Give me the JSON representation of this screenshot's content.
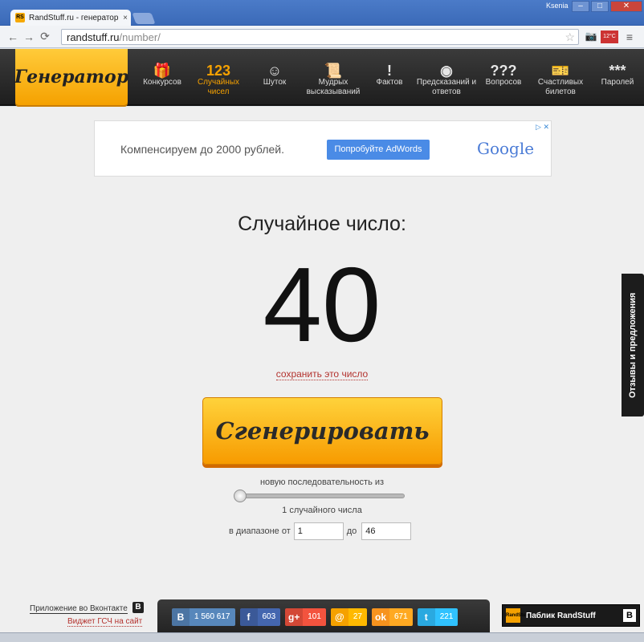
{
  "browser": {
    "tab_title": "RandStuff.ru - генератор сл",
    "tab_close": "×",
    "favicon_text": "RS",
    "user": "Ksenia",
    "window_buttons": {
      "minimize": "–",
      "maximize": "□",
      "close": "✕"
    },
    "nav": {
      "back": "←",
      "forward": "→",
      "reload": "⟳"
    },
    "url_host": "randstuff.ru",
    "url_path": "/number/",
    "star": "☆",
    "toolbar_icons": {
      "camera": "📷",
      "weather": "12°C",
      "menu": "≡"
    }
  },
  "site": {
    "logo": "Генератор",
    "menu": [
      {
        "icon": "🎁",
        "label": "Конкурсов"
      },
      {
        "icon": "123",
        "label": "Случайных чисел",
        "active": true
      },
      {
        "icon": "☺",
        "label": "Шуток"
      },
      {
        "icon": "📜",
        "label": "Мудрых высказываний"
      },
      {
        "icon": "!",
        "label": "Фактов"
      },
      {
        "icon": "◉",
        "label": "Предсказаний и ответов"
      },
      {
        "icon": "???",
        "label": "Вопросов"
      },
      {
        "icon": "🎫",
        "label": "Счастливых билетов"
      },
      {
        "icon": "***",
        "label": "Паролей"
      }
    ]
  },
  "ad": {
    "text": "Компенсируем до 2000 рублей.",
    "button": "Попробуйте AdWords",
    "brand": "Google",
    "close": "▷ ✕"
  },
  "result": {
    "title": "Случайное число:",
    "number": "40",
    "save_link": "сохранить это число"
  },
  "generator": {
    "button": "Сгенерировать",
    "sequence_label": "новую последовательность из",
    "count_label": "1 случайного числа",
    "range_from_label": "в диапазоне от",
    "range_from": "1",
    "range_to_label": "до",
    "range_to": "46",
    "slider_value": 1
  },
  "feedback": "Отзывы и предложения",
  "footer": {
    "vk_app": "Приложение во Вконтакте",
    "vk_badge": "B",
    "widget": "Виджет ГСЧ на сайт",
    "social": [
      {
        "icon": "B",
        "count": "1 560 617",
        "color": "#4c75a3"
      },
      {
        "icon": "f",
        "count": "603",
        "color": "#3b5998"
      },
      {
        "icon": "g+",
        "count": "101",
        "color": "#d34836"
      },
      {
        "icon": "@",
        "count": "27",
        "color": "#f5a100"
      },
      {
        "icon": "ok",
        "count": "671",
        "color": "#f7931e"
      },
      {
        "icon": "t",
        "count": "221",
        "color": "#2aa9e0"
      }
    ],
    "public": "Паблик RandStuff",
    "public_logo": "RandStuff",
    "public_badge": "B"
  }
}
